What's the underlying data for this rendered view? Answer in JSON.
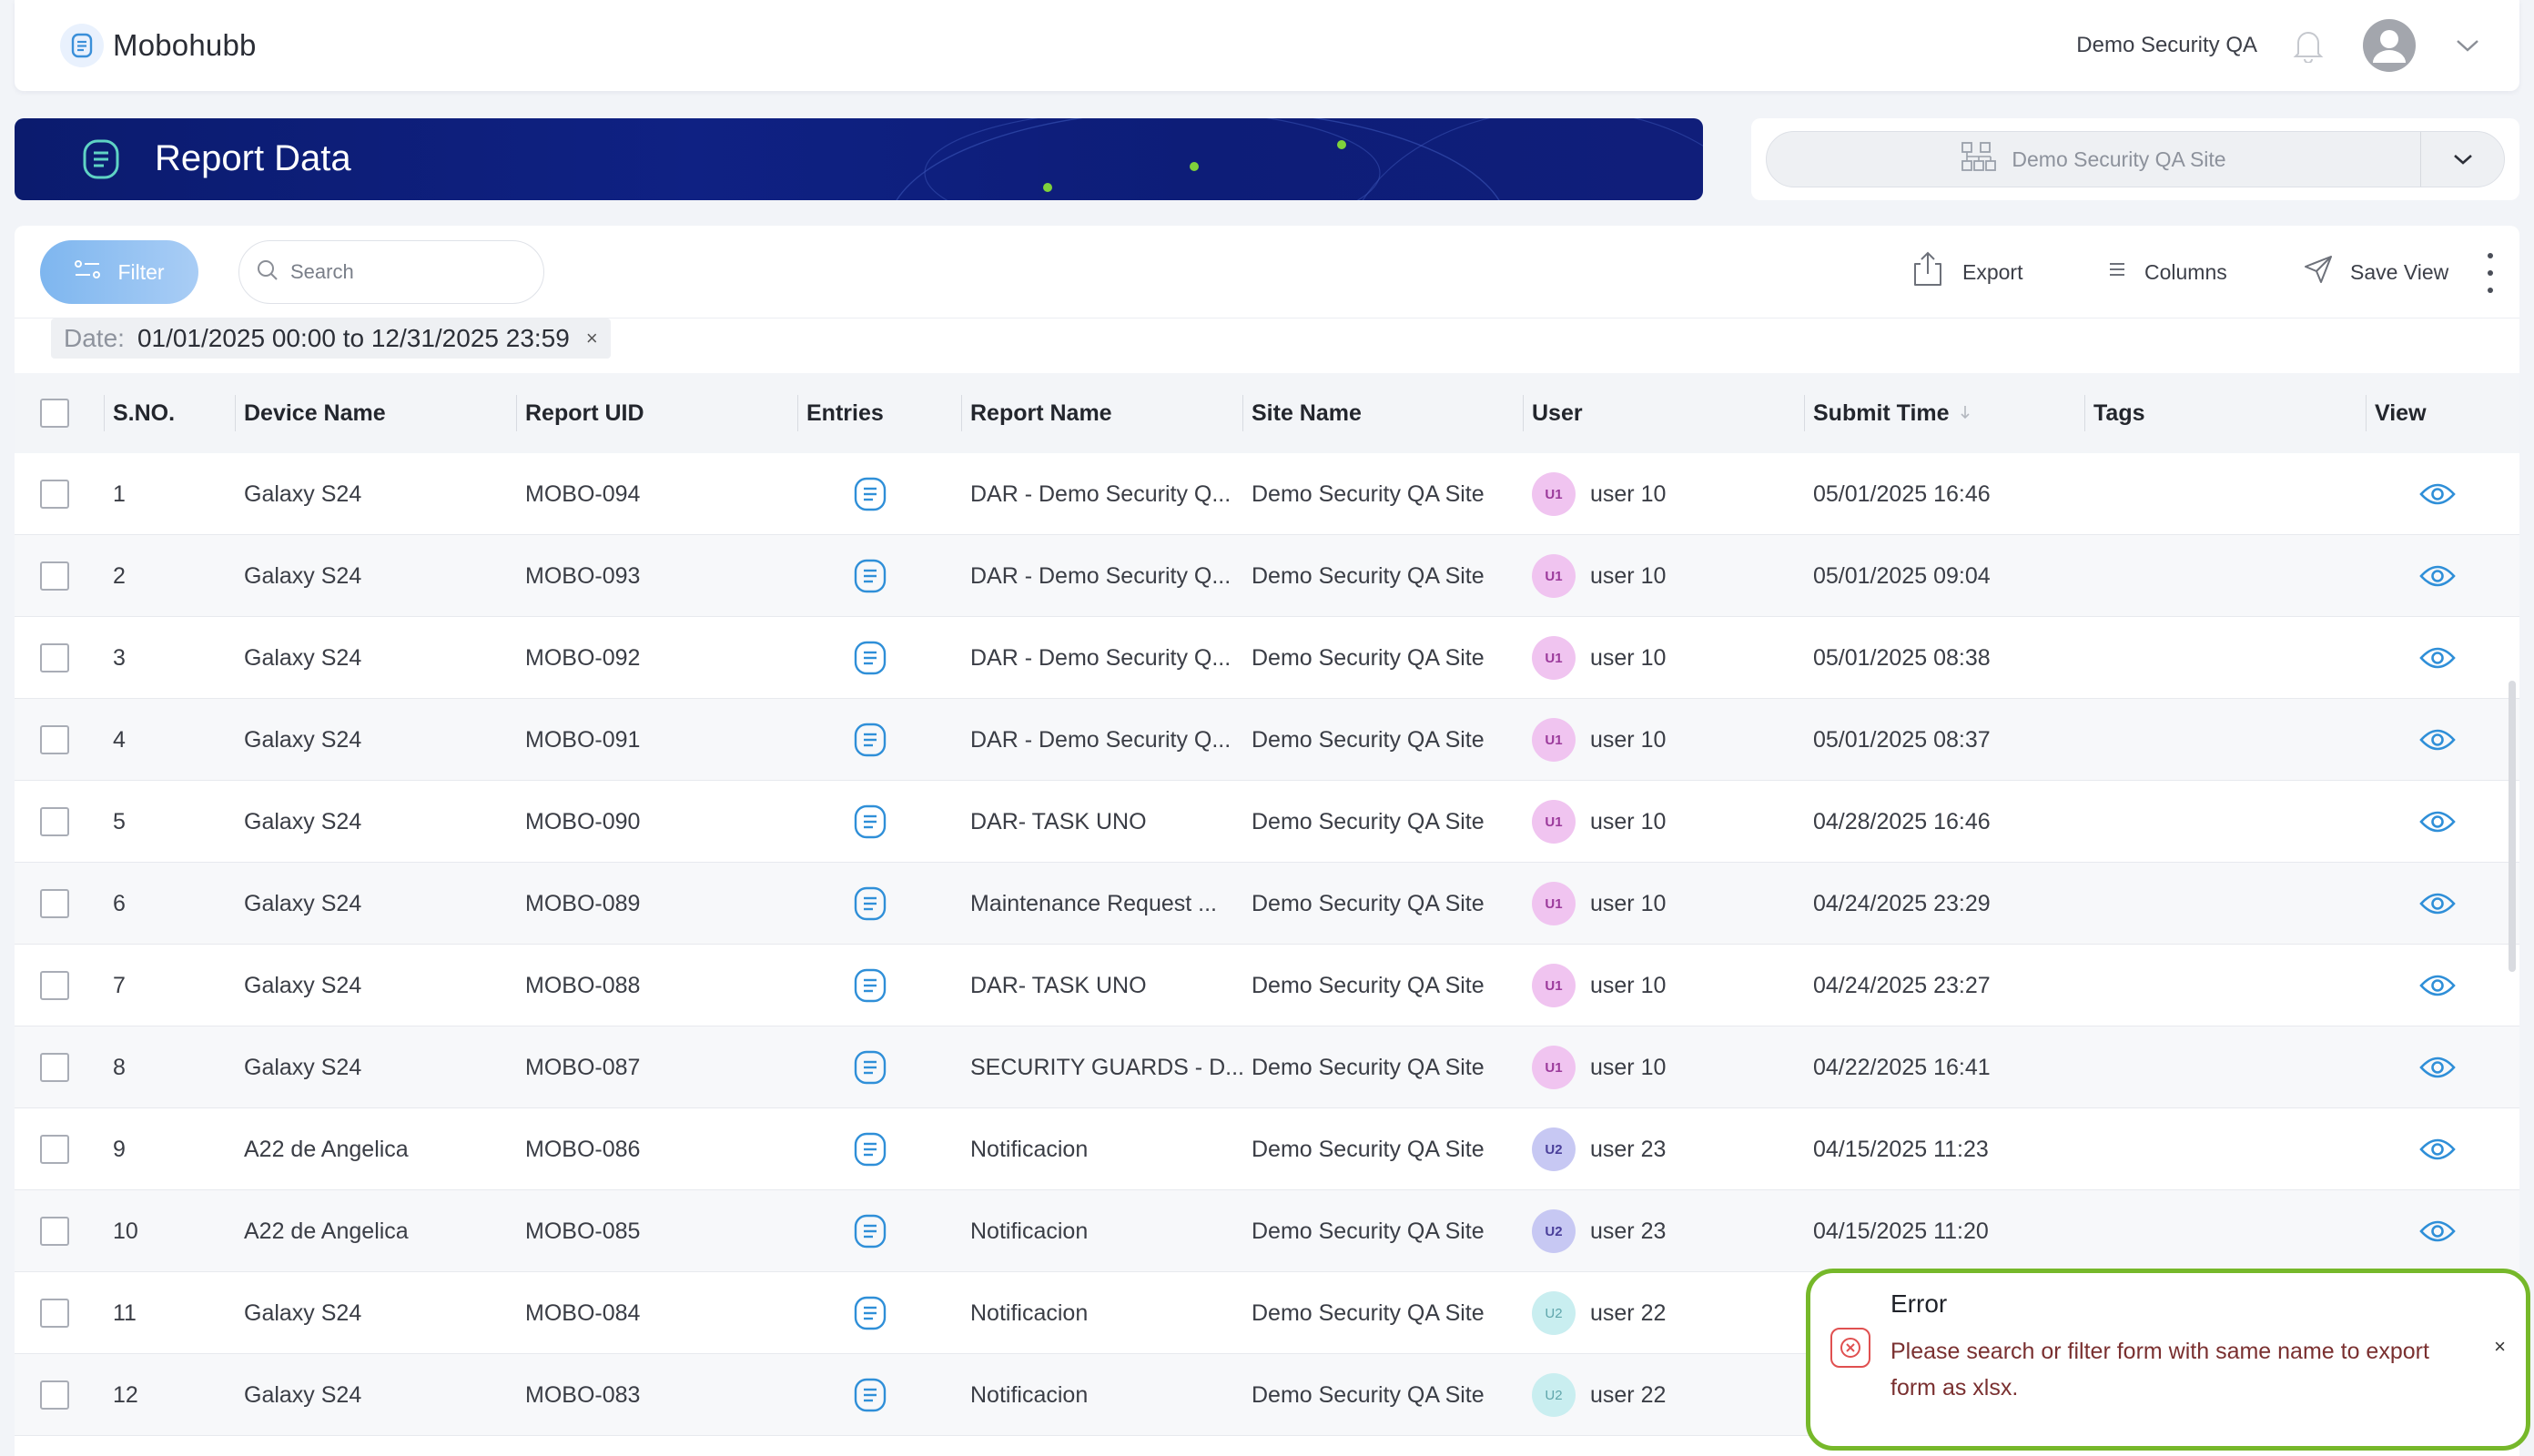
{
  "app": {
    "name": "Mobohubb"
  },
  "header": {
    "user_name": "Demo Security QA"
  },
  "banner": {
    "title": "Report Data"
  },
  "site_selector": {
    "selected": "Demo Security QA Site"
  },
  "toolbar": {
    "filter_label": "Filter",
    "search_placeholder": "Search",
    "export_label": "Export",
    "columns_label": "Columns",
    "save_view_label": "Save View"
  },
  "filter_chip": {
    "label": "Date:",
    "value": "01/01/2025 00:00 to 12/31/2025 23:59",
    "remove": "×"
  },
  "table": {
    "columns": [
      "S.NO.",
      "Device Name",
      "Report UID",
      "Entries",
      "Report Name",
      "Site Name",
      "User",
      "Submit Time",
      "Tags",
      "View"
    ],
    "rows": [
      {
        "sno": "1",
        "device": "Galaxy S24",
        "uid": "MOBO-094",
        "report": "DAR - Demo Security Q...",
        "site": "Demo Security QA Site",
        "badge": "U1",
        "user": "user 10",
        "time": "05/01/2025 16:46",
        "tags": ""
      },
      {
        "sno": "2",
        "device": "Galaxy S24",
        "uid": "MOBO-093",
        "report": "DAR - Demo Security Q...",
        "site": "Demo Security QA Site",
        "badge": "U1",
        "user": "user 10",
        "time": "05/01/2025 09:04",
        "tags": ""
      },
      {
        "sno": "3",
        "device": "Galaxy S24",
        "uid": "MOBO-092",
        "report": "DAR - Demo Security Q...",
        "site": "Demo Security QA Site",
        "badge": "U1",
        "user": "user 10",
        "time": "05/01/2025 08:38",
        "tags": ""
      },
      {
        "sno": "4",
        "device": "Galaxy S24",
        "uid": "MOBO-091",
        "report": "DAR - Demo Security Q...",
        "site": "Demo Security QA Site",
        "badge": "U1",
        "user": "user 10",
        "time": "05/01/2025 08:37",
        "tags": ""
      },
      {
        "sno": "5",
        "device": "Galaxy S24",
        "uid": "MOBO-090",
        "report": "DAR- TASK UNO",
        "site": "Demo Security QA Site",
        "badge": "U1",
        "user": "user 10",
        "time": "04/28/2025 16:46",
        "tags": ""
      },
      {
        "sno": "6",
        "device": "Galaxy S24",
        "uid": "MOBO-089",
        "report": "Maintenance Request ...",
        "site": "Demo Security QA Site",
        "badge": "U1",
        "user": "user 10",
        "time": "04/24/2025 23:29",
        "tags": ""
      },
      {
        "sno": "7",
        "device": "Galaxy S24",
        "uid": "MOBO-088",
        "report": "DAR- TASK UNO",
        "site": "Demo Security QA Site",
        "badge": "U1",
        "user": "user 10",
        "time": "04/24/2025 23:27",
        "tags": ""
      },
      {
        "sno": "8",
        "device": "Galaxy S24",
        "uid": "MOBO-087",
        "report": "SECURITY GUARDS - D...",
        "site": "Demo Security QA Site",
        "badge": "U1",
        "user": "user 10",
        "time": "04/22/2025 16:41",
        "tags": ""
      },
      {
        "sno": "9",
        "device": "A22 de Angelica",
        "uid": "MOBO-086",
        "report": "Notificacion",
        "site": "Demo Security QA Site",
        "badge": "U2",
        "user": "user 23",
        "time": "04/15/2025 11:23",
        "tags": ""
      },
      {
        "sno": "10",
        "device": "A22 de Angelica",
        "uid": "MOBO-085",
        "report": "Notificacion",
        "site": "Demo Security QA Site",
        "badge": "U2",
        "user": "user 23",
        "time": "04/15/2025 11:20",
        "tags": ""
      },
      {
        "sno": "11",
        "device": "Galaxy S24",
        "uid": "MOBO-084",
        "report": "Notificacion",
        "site": "Demo Security QA Site",
        "badge": "U2",
        "user": "user 22",
        "time": "",
        "tags": ""
      },
      {
        "sno": "12",
        "device": "Galaxy S24",
        "uid": "MOBO-083",
        "report": "Notificacion",
        "site": "Demo Security QA Site",
        "badge": "U2",
        "user": "user 22",
        "time": "",
        "tags": ""
      }
    ]
  },
  "toast": {
    "title": "Error",
    "message": "Please search or filter form with same name to export form as xlsx.",
    "close": "×"
  },
  "colors": {
    "accent": "#2f8fd8",
    "banner": "#0f2183",
    "toast_border": "#76b82a",
    "error": "#e05050"
  }
}
